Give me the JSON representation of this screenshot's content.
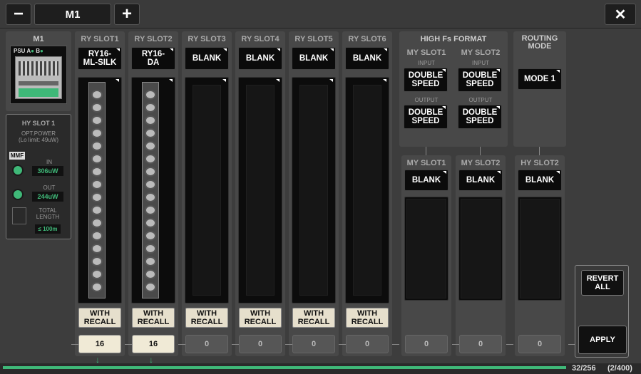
{
  "titlebar": {
    "minus_label": "−",
    "unit_name": "M1",
    "plus_label": "+",
    "close_label": "✕"
  },
  "m1": {
    "title": "M1",
    "psu_label": "PSU",
    "a_label": "A",
    "b_label": "B"
  },
  "hy_slot1": {
    "title": "HY SLOT 1",
    "opt_power": "OPT.POWER",
    "lo_limit": "(Lo limit: 49uW)",
    "mmf": "MMF",
    "in_label": "IN",
    "in_value": "306uW",
    "out_label": "OUT",
    "out_value": "244uW",
    "total_label": "TOTAL",
    "length_label": "LENGTH",
    "length_value": "≤ 100m"
  },
  "ry_slots": [
    {
      "header": "RY SLOT1",
      "card_line1": "RY16-",
      "card_line2": "ML-SILK",
      "with": "WITH",
      "recall": "RECALL",
      "count": "16",
      "active": true
    },
    {
      "header": "RY SLOT2",
      "card_line1": "RY16-",
      "card_line2": "DA",
      "with": "WITH",
      "recall": "RECALL",
      "count": "16",
      "active": true
    },
    {
      "header": "RY SLOT3",
      "card_line1": "BLANK",
      "card_line2": "",
      "with": "WITH",
      "recall": "RECALL",
      "count": "0",
      "active": false
    },
    {
      "header": "RY SLOT4",
      "card_line1": "BLANK",
      "card_line2": "",
      "with": "WITH",
      "recall": "RECALL",
      "count": "0",
      "active": false
    },
    {
      "header": "RY SLOT5",
      "card_line1": "BLANK",
      "card_line2": "",
      "with": "WITH",
      "recall": "RECALL",
      "count": "0",
      "active": false
    },
    {
      "header": "RY SLOT6",
      "card_line1": "BLANK",
      "card_line2": "",
      "with": "WITH",
      "recall": "RECALL",
      "count": "0",
      "active": false
    }
  ],
  "high_fs": {
    "title": "HIGH Fs FORMAT",
    "slot1": {
      "header": "MY SLOT1",
      "input_label": "INPUT",
      "input_value_1": "DOUBLE",
      "input_value_2": "SPEED",
      "output_label": "OUTPUT",
      "output_value_1": "DOUBLE",
      "output_value_2": "SPEED"
    },
    "slot2": {
      "header": "MY SLOT2",
      "input_label": "INPUT",
      "input_value_1": "DOUBLE",
      "input_value_2": "SPEED",
      "output_label": "OUTPUT",
      "output_value_1": "DOUBLE",
      "output_value_2": "SPEED"
    }
  },
  "routing": {
    "title_1": "ROUTING",
    "title_2": "MODE",
    "mode_value": "MODE 1"
  },
  "lower_slots": [
    {
      "header": "MY SLOT1",
      "card": "BLANK",
      "count": "0"
    },
    {
      "header": "MY SLOT2",
      "card": "BLANK",
      "count": "0"
    },
    {
      "header": "HY SLOT2",
      "card": "BLANK",
      "count": "0"
    }
  ],
  "actions": {
    "revert_1": "REVERT",
    "revert_2": "ALL",
    "apply": "APPLY"
  },
  "status": {
    "channel_count": "32/256",
    "total_count": "(2/400)",
    "arrow": "↓"
  },
  "colors": {
    "accent_green": "#3fb878",
    "active_button": "#f0ead6"
  }
}
